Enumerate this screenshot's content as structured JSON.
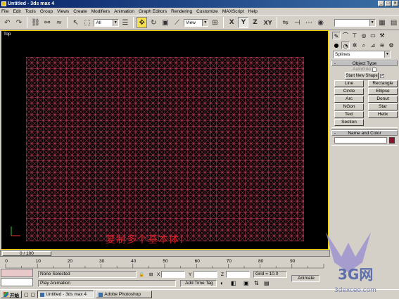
{
  "window": {
    "title": "Untitled - 3ds max 4",
    "min": "_",
    "max": "□",
    "close": "×"
  },
  "menu": [
    "File",
    "Edit",
    "Tools",
    "Group",
    "Views",
    "Create",
    "Modifiers",
    "Animation",
    "Graph Editors",
    "Rendering",
    "Customize",
    "MAXScript",
    "Help"
  ],
  "toolbar": {
    "filter_value": "All",
    "refcoord_value": "View",
    "axis_x": "X",
    "axis_y": "Y",
    "axis_z": "Z",
    "axis_xy": "XY",
    "named_sel_value": ""
  },
  "viewport": {
    "label": "Top",
    "caption": "复制多个基本体!"
  },
  "command_panel": {
    "category_dropdown": "Splines",
    "object_type": {
      "title": "Object Type",
      "autogrid": "AutoGrid",
      "start_new_shape": "Start New Shape",
      "buttons": [
        "Line",
        "Rectangle",
        "Circle",
        "Ellipse",
        "Arc",
        "Donut",
        "NGon",
        "Star",
        "Text",
        "Helix",
        "Section"
      ]
    },
    "name_color": {
      "title": "Name and Color",
      "color": "#8a1230"
    }
  },
  "timeline": {
    "slider_label": "0 / 100",
    "ticks": [
      "0",
      "10",
      "20",
      "30",
      "40",
      "50",
      "60",
      "70",
      "80",
      "90"
    ]
  },
  "status": {
    "selection": "None Selected",
    "prompt": "Play Animation",
    "add_time_tag": "Add Time Tag",
    "x_label": "X",
    "y_label": "Y",
    "z_label": "Z",
    "grid_label": "Grid = 10.0",
    "animate_label": "Animate",
    "x_value": "",
    "y_value": "",
    "z_value": ""
  },
  "taskbar": {
    "start": "开始",
    "tasks": [
      "Untitled - 3ds max 4",
      "Adobe Photoshop"
    ]
  },
  "watermark": {
    "brand": "3G网",
    "url": "3dexceo.com"
  }
}
